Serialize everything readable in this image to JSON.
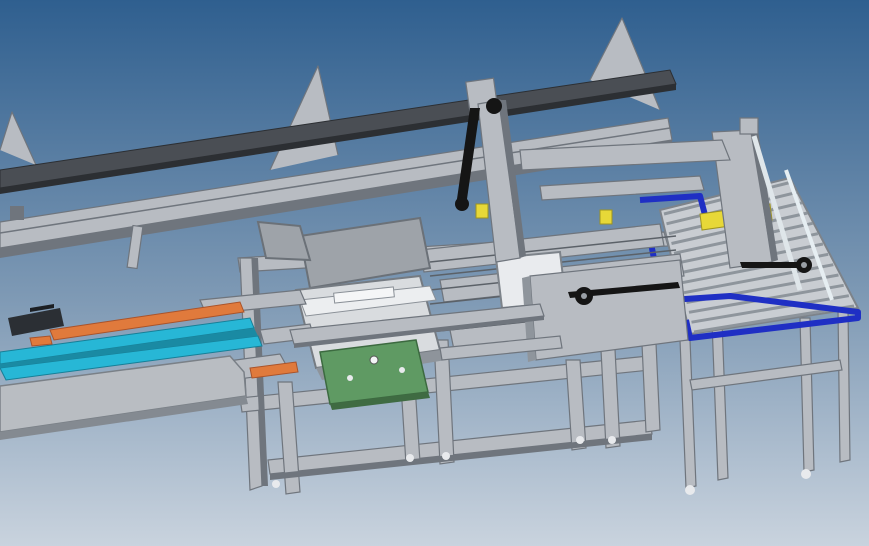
{
  "viewport": {
    "background_top": "#2f5f8f",
    "background_bottom": "#c9d3de"
  },
  "colors": {
    "frame_aluminum": "#b8bcc2",
    "frame_shadow": "#6f757d",
    "rail_dark": "#4a4e54",
    "conveyor_belt_cyan": "#27b7d6",
    "conveyor_belt_orange": "#e07a3c",
    "electrical_box_green": "#5f9a63",
    "guard_blue": "#1f2fc4",
    "accent_yellow": "#e7d838",
    "timing_belt_black": "#151515"
  }
}
